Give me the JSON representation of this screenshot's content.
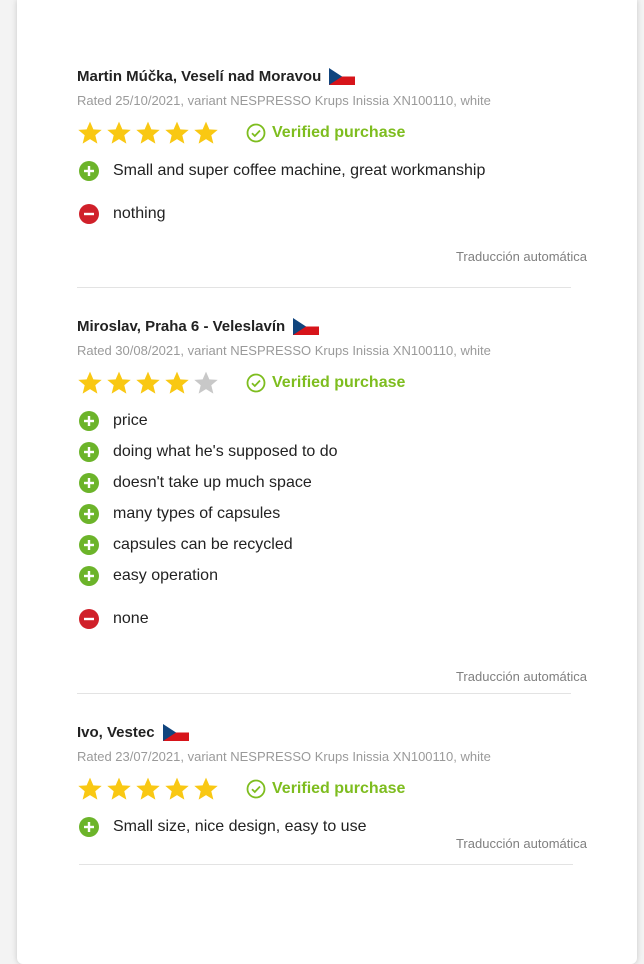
{
  "colors": {
    "star_filled": "#f9c813",
    "star_empty": "#c8c8c8",
    "verified": "#7ebd1f",
    "pro": "#6cb42a",
    "con": "#d0202a"
  },
  "reviews": [
    {
      "author": "Martin Múčka, Veselí nad Moravou",
      "flag": "czech-flag-icon",
      "meta": "Rated 25/10/2021, variant NESPRESSO Krups Inissia XN100110, white",
      "stars": 5,
      "verified": "Verified purchase",
      "pros": [
        "Small and super coffee machine, great workmanship"
      ],
      "cons": [
        "nothing"
      ],
      "translation": "Traducción automática"
    },
    {
      "author": "Miroslav, Praha 6 - Veleslavín",
      "flag": "czech-flag-icon",
      "meta": "Rated 30/08/2021, variant NESPRESSO Krups Inissia XN100110, white",
      "stars": 4,
      "verified": "Verified purchase",
      "pros": [
        "price",
        "doing what he's supposed to do",
        "doesn't take up much space",
        "many types of capsules",
        "capsules can be recycled",
        "easy operation"
      ],
      "cons": [
        "none"
      ],
      "translation": "Traducción automática"
    },
    {
      "author": "Ivo, Vestec",
      "flag": "czech-flag-icon",
      "meta": "Rated 23/07/2021, variant NESPRESSO Krups Inissia XN100110, white",
      "stars": 5,
      "verified": "Verified purchase",
      "pros": [
        "Small size, nice design, easy to use"
      ],
      "cons": [],
      "translation": "Traducción automática"
    }
  ]
}
